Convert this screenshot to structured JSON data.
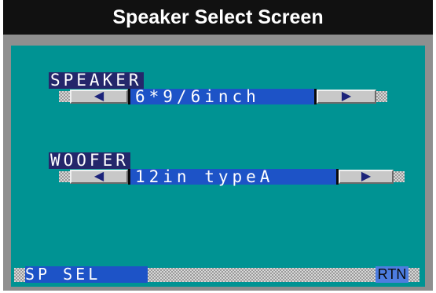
{
  "window": {
    "title": "Speaker Select Screen"
  },
  "speaker": {
    "label": "SPEAKER",
    "left_arrow": "◀",
    "value": "6*9/6inch",
    "right_arrow": "▶"
  },
  "woofer": {
    "label": "WOOFER",
    "left_arrow": "◀",
    "value": "12in typeA",
    "right_arrow": "▶"
  },
  "footer": {
    "sp_sel_label": "SP SEL",
    "rtn_label": "RTN"
  },
  "colors": {
    "screen_bg": "#009393",
    "frame": "#8f8f8f",
    "label_bg": "#24276b",
    "value_bg": "#1d53c7",
    "title_bg": "#111111"
  }
}
